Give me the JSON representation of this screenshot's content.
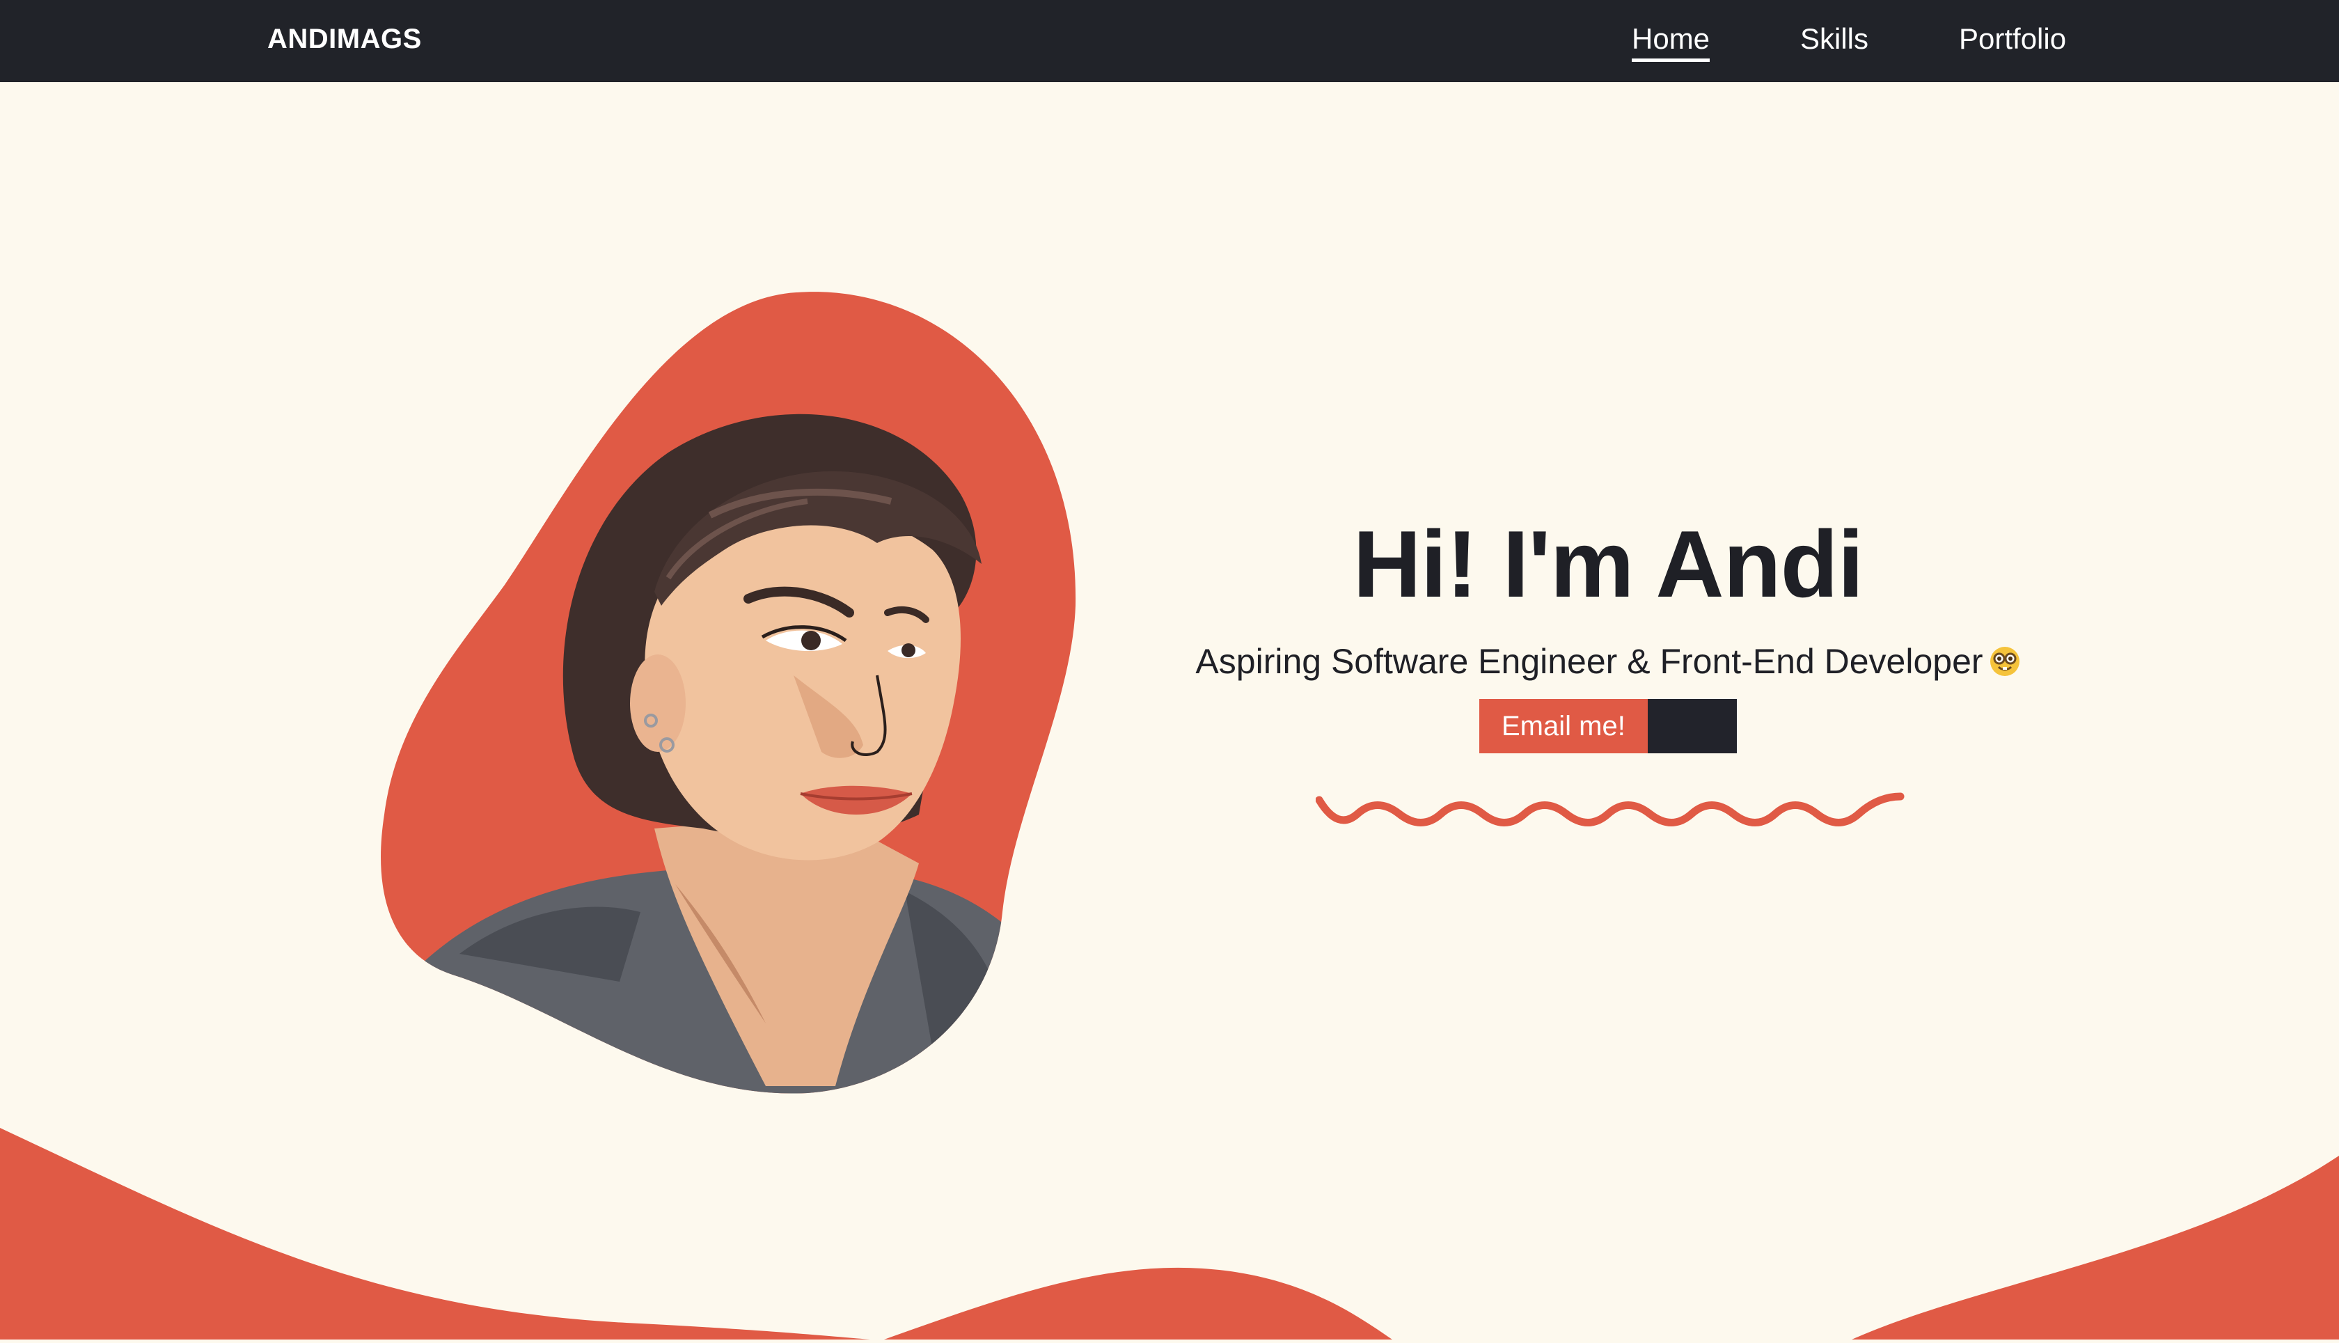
{
  "nav": {
    "brand": "ANDIMAGS",
    "items": [
      "Home",
      "Skills",
      "Portfolio"
    ],
    "active": "Home"
  },
  "hero": {
    "title": "Hi! I'm Andi",
    "subtitle": "Aspiring Software Engineer & Front-End Developer",
    "emoji_icon": "nerd-face-icon",
    "email_button": "Email me!"
  },
  "colors": {
    "nav_bg": "#212329",
    "page_bg": "#fdf9ee",
    "accent": "#e05a45",
    "text": "#1f2026"
  }
}
